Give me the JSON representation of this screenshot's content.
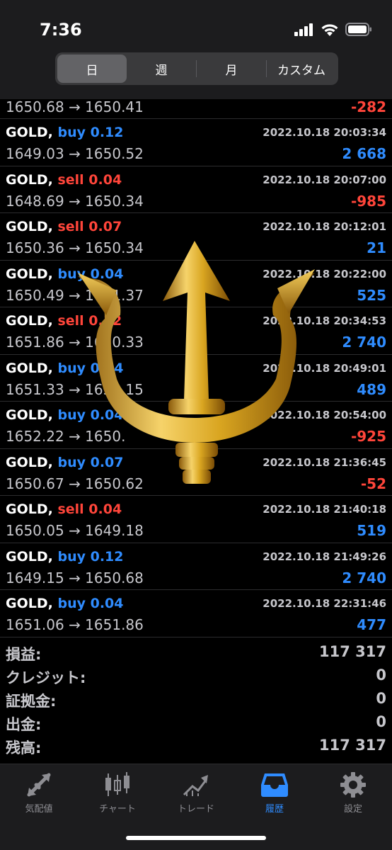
{
  "status": {
    "time": "7:36"
  },
  "period_tabs": [
    {
      "label": "日",
      "active": true
    },
    {
      "label": "週",
      "active": false
    },
    {
      "label": "月",
      "active": false
    },
    {
      "label": "カスタム",
      "active": false
    }
  ],
  "partial_row": {
    "prices": "1650.68 → 1650.41",
    "profit": "-282"
  },
  "trades": [
    {
      "symbol": "GOLD,",
      "side": "buy 0.12",
      "type": "buy",
      "date": "2022.10.18 20:03:34",
      "prices": "1649.03 → 1650.52",
      "profit": "2 668",
      "sign": "pos"
    },
    {
      "symbol": "GOLD,",
      "side": "sell 0.04",
      "type": "sell",
      "date": "2022.10.18 20:07:00",
      "prices": "1648.69 → 1650.34",
      "profit": "-985",
      "sign": "neg"
    },
    {
      "symbol": "GOLD,",
      "side": "sell 0.07",
      "type": "sell",
      "date": "2022.10.18 20:12:01",
      "prices": "1650.36 → 1650.34",
      "profit": "21",
      "sign": "pos"
    },
    {
      "symbol": "GOLD,",
      "side": "buy 0.04",
      "type": "buy",
      "date": "2022.10.18 20:22:00",
      "prices": "1650.49 → 1651.37",
      "profit": "525",
      "sign": "pos"
    },
    {
      "symbol": "GOLD,",
      "side": "sell 0.12",
      "type": "sell",
      "date": "2022.10.18 20:34:53",
      "prices": "1651.86 → 1650.33",
      "profit": "2 740",
      "sign": "pos"
    },
    {
      "symbol": "GOLD,",
      "side": "buy 0.04",
      "type": "buy",
      "date": "2022.10.18 20:49:01",
      "prices": "1651.33 → 1652.15",
      "profit": "489",
      "sign": "pos"
    },
    {
      "symbol": "GOLD,",
      "side": "buy 0.04",
      "type": "buy",
      "date": "2022.10.18 20:54:00",
      "prices": "1652.22 → 1650.",
      "profit": "-925",
      "sign": "neg"
    },
    {
      "symbol": "GOLD,",
      "side": "buy 0.07",
      "type": "buy",
      "date": "2022.10.18 21:36:45",
      "prices": "1650.67 → 1650.62",
      "profit": "-52",
      "sign": "neg"
    },
    {
      "symbol": "GOLD,",
      "side": "sell 0.04",
      "type": "sell",
      "date": "2022.10.18 21:40:18",
      "prices": "1650.05 → 1649.18",
      "profit": "519",
      "sign": "pos"
    },
    {
      "symbol": "GOLD,",
      "side": "buy 0.12",
      "type": "buy",
      "date": "2022.10.18 21:49:26",
      "prices": "1649.15 → 1650.68",
      "profit": "2 740",
      "sign": "pos"
    },
    {
      "symbol": "GOLD,",
      "side": "buy 0.04",
      "type": "buy",
      "date": "2022.10.18 22:31:46",
      "prices": "1651.06 → 1651.86",
      "profit": "477",
      "sign": "pos"
    }
  ],
  "summary": [
    {
      "label": "損益:",
      "value": "117 317"
    },
    {
      "label": "クレジット:",
      "value": "0"
    },
    {
      "label": "証拠金:",
      "value": "0"
    },
    {
      "label": "出金:",
      "value": "0"
    },
    {
      "label": "残高:",
      "value": "117 317"
    }
  ],
  "tabbar": [
    {
      "label": "気配値",
      "icon": "quotes-arrows-icon",
      "active": false
    },
    {
      "label": "チャート",
      "icon": "candlestick-chart-icon",
      "active": false
    },
    {
      "label": "トレード",
      "icon": "trade-chart-icon",
      "active": false
    },
    {
      "label": "履歴",
      "icon": "inbox-tray-icon",
      "active": true
    },
    {
      "label": "設定",
      "icon": "gear-icon",
      "active": false
    }
  ],
  "colors": {
    "buy": "#2f8cff",
    "sell": "#ff453a",
    "active_tab": "#2f8cff",
    "inactive_tab": "#8e8e93",
    "trident_gold": "#d9a520"
  }
}
